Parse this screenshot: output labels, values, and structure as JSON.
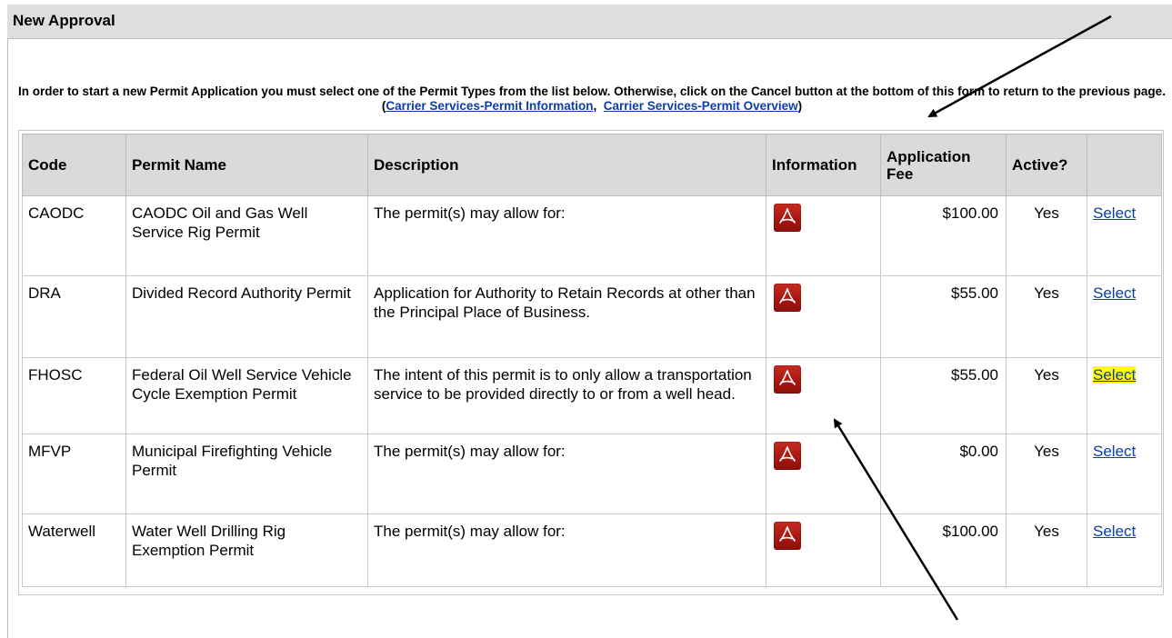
{
  "page": {
    "title": "New Approval",
    "instructions_text": "In order to start a new Permit Application you must select one of the Permit Types from the list below. Otherwise, click on the Cancel button at the bottom of this form to return to the previous page.(",
    "link1": "Carrier Services-Permit Information",
    "separator": ",  ",
    "link2": "Carrier Services-Permit Overview",
    "closing": ")"
  },
  "table": {
    "headers": {
      "code": "Code",
      "name": "Permit Name",
      "description": "Description",
      "information": "Information",
      "fee": "Application Fee",
      "active": "Active?"
    },
    "rows": [
      {
        "code": "CAODC",
        "name": "CAODC Oil and Gas Well Service Rig Permit",
        "description": "The permit(s) may allow for:",
        "fee": "$100.00",
        "active": "Yes",
        "action": "Select",
        "icon": "pdf-icon"
      },
      {
        "code": "DRA",
        "name": "Divided Record Authority Permit",
        "description": "Application for Authority to Retain Records at other than the Principal Place of Business.",
        "fee": "$55.00",
        "active": "Yes",
        "action": "Select",
        "icon": "pdf-icon"
      },
      {
        "code": "FHOSC",
        "name": "Federal Oil Well Service Vehicle Cycle Exemption Permit",
        "description": "The intent of this permit is to only allow a transportation service to be provided directly to or from a well head.",
        "fee": "$55.00",
        "active": "Yes",
        "action": "Select",
        "icon": "pdf-icon"
      },
      {
        "code": "MFVP",
        "name": "Municipal Firefighting Vehicle Permit",
        "description": "The permit(s) may allow for:",
        "fee": "$0.00",
        "active": "Yes",
        "action": "Select",
        "icon": "pdf-icon"
      },
      {
        "code": "Waterwell",
        "name": "Water Well Drilling Rig Exemption Permit",
        "description": "The permit(s) may allow for:",
        "fee": "$100.00",
        "active": "Yes",
        "action": "Select",
        "icon": "pdf-icon"
      }
    ]
  },
  "colors": {
    "header_bg": "#dedede",
    "link": "#0b3ea8",
    "highlight": "#ffff00",
    "pdf_red": "#b41c14"
  }
}
